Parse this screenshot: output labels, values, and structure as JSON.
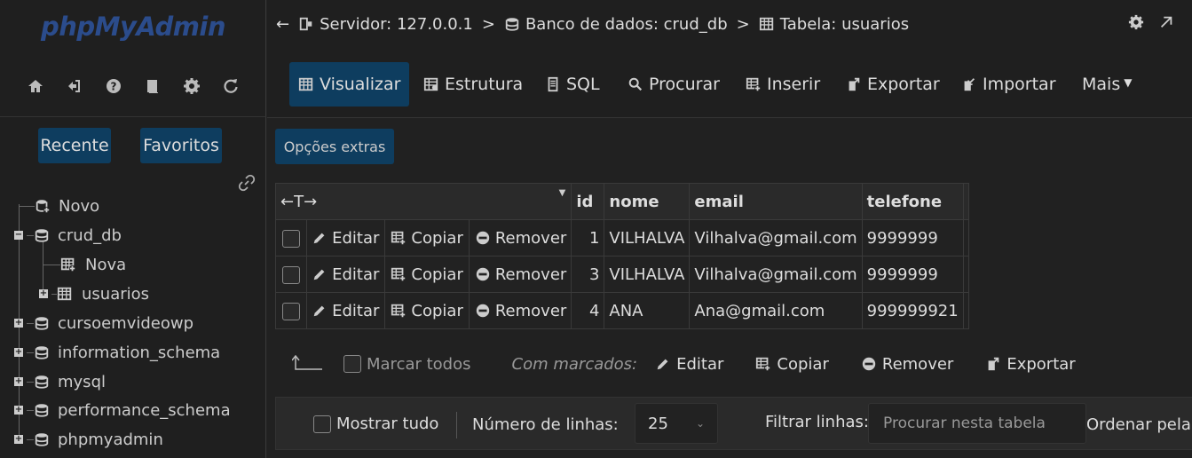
{
  "app": {
    "logo": "phpMyAdmin"
  },
  "breadcrumb": {
    "server": "Servidor: 127.0.0.1",
    "database": "Banco de dados: crud_db",
    "table": "Tabela: usuarios"
  },
  "sidebar": {
    "icons": [
      "home-icon",
      "logout-icon",
      "help-icon",
      "docs-icon",
      "settings-icon",
      "reload-icon"
    ],
    "recent": "Recente",
    "favorites": "Favoritos",
    "tree": [
      {
        "label": "Novo"
      },
      {
        "label": "crud_db"
      },
      {
        "label": "Nova"
      },
      {
        "label": "usuarios"
      },
      {
        "label": "cursoemvideowp"
      },
      {
        "label": "information_schema"
      },
      {
        "label": "mysql"
      },
      {
        "label": "performance_schema"
      },
      {
        "label": "phpmyadmin"
      }
    ]
  },
  "tabs": [
    "Visualizar",
    "Estrutura",
    "SQL",
    "Procurar",
    "Inserir",
    "Exportar",
    "Importar",
    "Mais"
  ],
  "active_tab": "Visualizar",
  "main": {
    "extra_options": "Opções extras"
  },
  "table": {
    "columns": [
      "id",
      "nome",
      "email",
      "telefone"
    ],
    "actions": [
      "Editar",
      "Copiar",
      "Remover"
    ],
    "rows": [
      {
        "id": "1",
        "nome": "VILHALVA",
        "email": "Vilhalva@gmail.com",
        "telefone": "9999999"
      },
      {
        "id": "3",
        "nome": "VILHALVA",
        "email": "Vilhalva@gmail.com",
        "telefone": "9999999"
      },
      {
        "id": "4",
        "nome": "ANA",
        "email": "Ana@gmail.com",
        "telefone": "999999921"
      }
    ]
  },
  "bulk": {
    "check_all": "Marcar todos",
    "with_selected": "Com marcados:",
    "edit": "Editar",
    "copy": "Copiar",
    "delete": "Remover",
    "export": "Exportar"
  },
  "bottom": {
    "show_all": "Mostrar tudo",
    "rows_label": "Número de linhas:",
    "rows_value": "25",
    "filter_label": "Filtrar linhas:",
    "filter_placeholder": "Procurar nesta tabela",
    "sort_label": "Ordenar pela"
  },
  "colors": {
    "accent": "#0e3d5f",
    "background": "#222222",
    "logo": "#2b4c8c"
  }
}
